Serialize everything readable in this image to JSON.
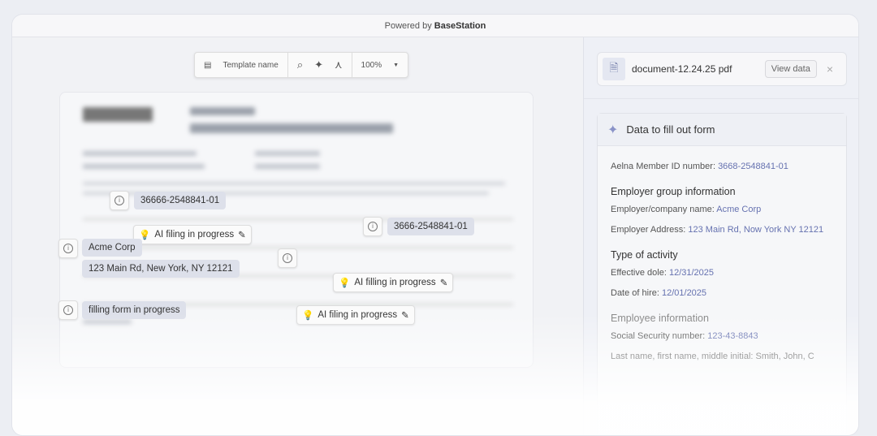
{
  "header": {
    "powered_by": "Powered by",
    "brand": "BaseStation"
  },
  "toolbar": {
    "template_name": "Template name",
    "zoom": "100%",
    "icons": [
      "template-icon",
      "search-icon",
      "sparkle-icon",
      "person-icon",
      "chevron-down-icon"
    ]
  },
  "overlays": {
    "chips": [
      "36666-2548841-01",
      "3666-2548841-01",
      "Acme Corp",
      "123 Main Rd, New York, NY 12121",
      "filling form in progress"
    ],
    "ai": [
      "AI filing in progress",
      "AI filling in progress",
      "AI filing in progress"
    ]
  },
  "file": {
    "name": "document-12.24.25 pdf",
    "view_label": "View data",
    "close": "×"
  },
  "panel": {
    "title": "Data to fill out form",
    "member_label": "Aelna Member ID number:",
    "member_value": "3668-2548841-01",
    "employer_section": "Employer group information",
    "company_label": "Employer/company name:",
    "company_value": "Acme Corp",
    "address_label": "Employer Address:",
    "address_value": "123 Main Rd, Now York  NY 12121",
    "activity_section": "Type of activity",
    "effective_label": "Effective dole:",
    "effective_value": "12/31/2025",
    "hire_label": "Date of hire:",
    "hire_value": "12/01/2025",
    "employee_section": "Employee information",
    "ssn_label": "Social Security number:",
    "ssn_value": "123-43-8843",
    "name_label": "Last name, first name, middle initial:",
    "name_value": "Smith, John, C"
  },
  "colors": {
    "accent": "#6672b0",
    "chip": "#dde0ea"
  }
}
